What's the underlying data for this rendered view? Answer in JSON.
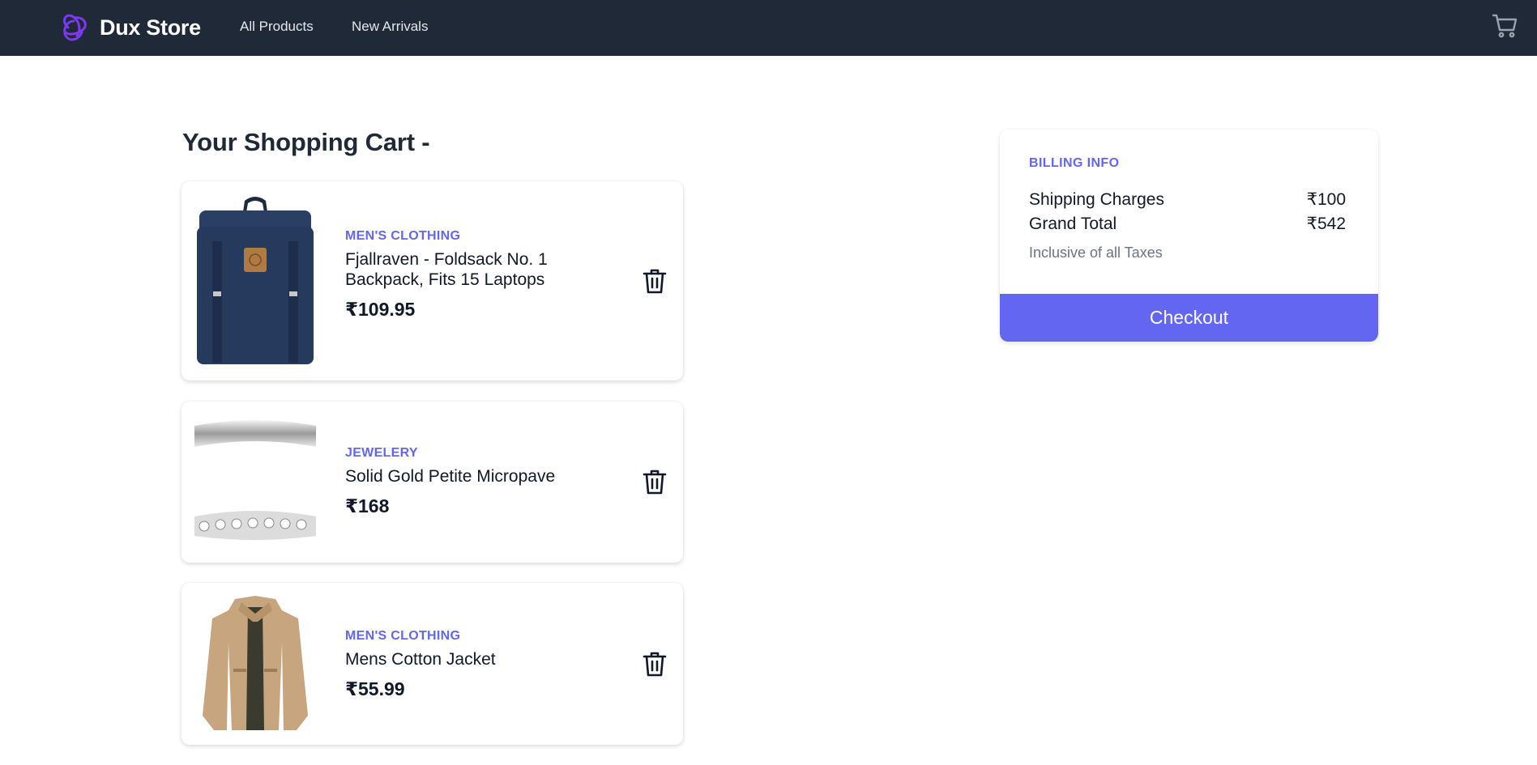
{
  "navbar": {
    "brand": "Dux Store",
    "logo_icon": "atom-logo-icon",
    "links": [
      "All Products",
      "New Arrivals"
    ],
    "cart_icon": "shopping-cart-icon",
    "background": "#1f2937"
  },
  "cart": {
    "title": "Your Shopping Cart -",
    "items": [
      {
        "category": "MEN'S CLOTHING",
        "title": "Fjallraven - Foldsack No. 1 Backpack, Fits 15 Laptops",
        "price": "₹109.95",
        "image": "navy backpack"
      },
      {
        "category": "JEWELERY",
        "title": "Solid Gold Petite Micropave",
        "price": "₹168",
        "image": "silver ring"
      },
      {
        "category": "MEN'S CLOTHING",
        "title": "Mens Cotton Jacket",
        "price": "₹55.99",
        "image": "khaki jacket"
      }
    ]
  },
  "billing": {
    "heading": "BILLING INFO",
    "rows": [
      {
        "label": "Shipping Charges",
        "value": "₹100"
      },
      {
        "label": "Grand Total",
        "value": "₹542"
      }
    ],
    "note": "Inclusive of all Taxes",
    "checkout_label": "Checkout"
  },
  "colors": {
    "accent": "#6366f1",
    "nav_bg": "#1f2937",
    "text": "#111827",
    "muted": "#6b7280"
  }
}
